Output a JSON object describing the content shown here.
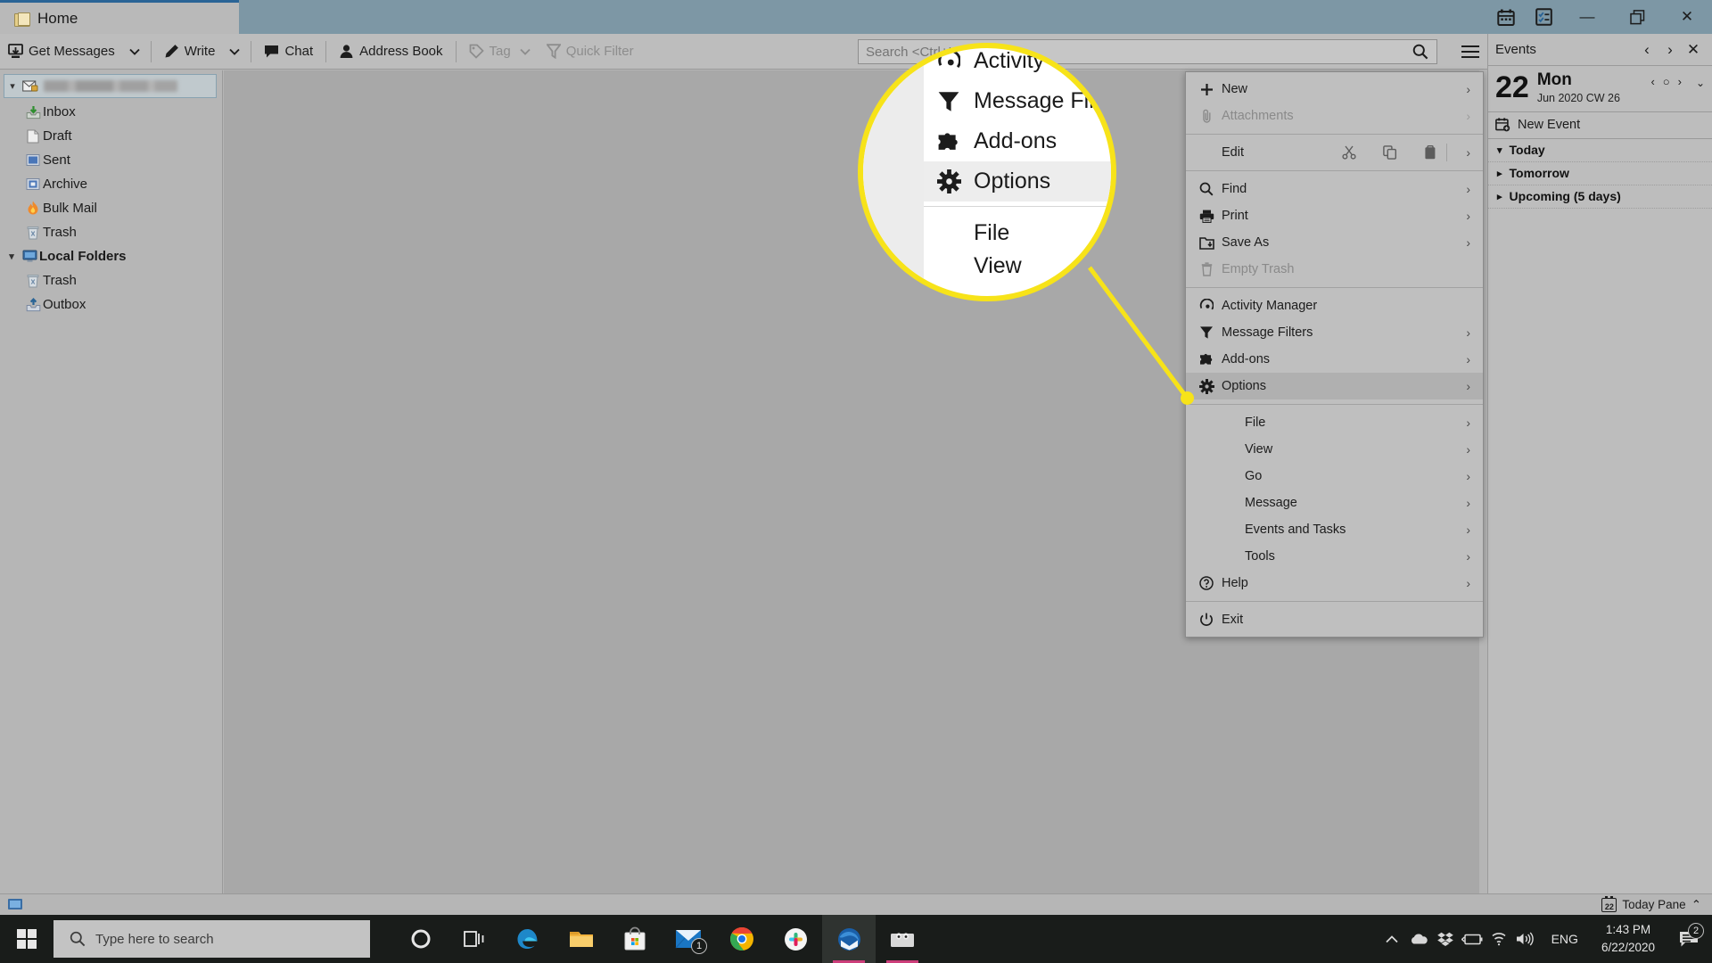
{
  "window": {
    "tab_label": "Home",
    "tab_icon": "folder-icon",
    "titlebar_buttons": [
      {
        "name": "calendar-icon",
        "label": "Calendar"
      },
      {
        "name": "tasks-icon",
        "label": "Tasks"
      }
    ],
    "controls": [
      {
        "name": "minimize-button",
        "glyph": "—"
      },
      {
        "name": "restore-button",
        "glyph": "❐"
      },
      {
        "name": "close-button",
        "glyph": "✕"
      }
    ]
  },
  "toolbar": {
    "get_messages": "Get Messages",
    "write": "Write",
    "chat": "Chat",
    "address_book": "Address Book",
    "tag": "Tag",
    "quick_filter": "Quick Filter",
    "search_placeholder": "Search <Ctrl+K>",
    "search_value": "",
    "app_menu_button": "hamburger-icon"
  },
  "folder_pane": {
    "account_row": {
      "label": "",
      "blurred": true,
      "icon": "mail-account-icon"
    },
    "account_folders": [
      {
        "label": "Inbox",
        "icon": "inbox-icon"
      },
      {
        "label": "Draft",
        "icon": "draft-icon"
      },
      {
        "label": "Sent",
        "icon": "sent-icon"
      },
      {
        "label": "Archive",
        "icon": "archive-icon"
      },
      {
        "label": "Bulk Mail",
        "icon": "bulk-mail-icon"
      },
      {
        "label": "Trash",
        "icon": "trash-icon"
      }
    ],
    "local_folders": {
      "label": "Local Folders",
      "icon": "local-folders-icon",
      "children": [
        {
          "label": "Trash",
          "icon": "trash-icon"
        },
        {
          "label": "Outbox",
          "icon": "outbox-icon"
        }
      ]
    }
  },
  "app_menu": {
    "groups": [
      {
        "items": [
          {
            "label": "New",
            "icon": "plus-icon",
            "submenu": true,
            "disabled": false,
            "selected": false,
            "indent": false
          },
          {
            "label": "Attachments",
            "icon": "paperclip-icon",
            "submenu": true,
            "disabled": true,
            "selected": false,
            "indent": false
          }
        ]
      },
      {
        "items": [
          {
            "label": "Edit",
            "icon": "",
            "submenu": true,
            "disabled": false,
            "selected": false,
            "indent": false,
            "edit_buttons": [
              "cut-icon",
              "copy-icon",
              "paste-icon"
            ]
          }
        ]
      },
      {
        "items": [
          {
            "label": "Find",
            "icon": "search-icon",
            "submenu": true,
            "disabled": false,
            "selected": false,
            "indent": false
          },
          {
            "label": "Print",
            "icon": "printer-icon",
            "submenu": true,
            "disabled": false,
            "selected": false,
            "indent": false
          },
          {
            "label": "Save As",
            "icon": "save-as-icon",
            "submenu": true,
            "disabled": false,
            "selected": false,
            "indent": false
          },
          {
            "label": "Empty Trash",
            "icon": "trash-icon",
            "submenu": false,
            "disabled": true,
            "selected": false,
            "indent": false
          }
        ]
      },
      {
        "items": [
          {
            "label": "Activity Manager",
            "icon": "activity-icon",
            "submenu": false,
            "disabled": false,
            "selected": false,
            "indent": false
          },
          {
            "label": "Message Filters",
            "icon": "filter-icon",
            "submenu": true,
            "disabled": false,
            "selected": false,
            "indent": false
          },
          {
            "label": "Add-ons",
            "icon": "puzzle-icon",
            "submenu": true,
            "disabled": false,
            "selected": false,
            "indent": false
          },
          {
            "label": "Options",
            "icon": "gear-icon",
            "submenu": true,
            "disabled": false,
            "selected": true,
            "indent": false
          }
        ]
      },
      {
        "items": [
          {
            "label": "File",
            "icon": "",
            "submenu": true,
            "disabled": false,
            "selected": false,
            "indent": true
          },
          {
            "label": "View",
            "icon": "",
            "submenu": true,
            "disabled": false,
            "selected": false,
            "indent": true
          },
          {
            "label": "Go",
            "icon": "",
            "submenu": true,
            "disabled": false,
            "selected": false,
            "indent": true
          },
          {
            "label": "Message",
            "icon": "",
            "submenu": true,
            "disabled": false,
            "selected": false,
            "indent": true
          },
          {
            "label": "Events and Tasks",
            "icon": "",
            "submenu": true,
            "disabled": false,
            "selected": false,
            "indent": true
          },
          {
            "label": "Tools",
            "icon": "",
            "submenu": true,
            "disabled": false,
            "selected": false,
            "indent": true
          },
          {
            "label": "Help",
            "icon": "help-icon",
            "submenu": true,
            "disabled": false,
            "selected": false,
            "indent": false
          }
        ]
      },
      {
        "items": [
          {
            "label": "Exit",
            "icon": "power-icon",
            "submenu": false,
            "disabled": false,
            "selected": false,
            "indent": false
          }
        ]
      }
    ]
  },
  "magnifier": {
    "highlight_color": "#f7e319",
    "items": [
      {
        "label": "Activity",
        "icon": "activity-icon",
        "highlighted": false
      },
      {
        "label": "Message Filte",
        "icon": "filter-icon",
        "highlighted": false
      },
      {
        "label": "Add-ons",
        "icon": "puzzle-icon",
        "highlighted": false
      },
      {
        "label": "Options",
        "icon": "gear-icon",
        "highlighted": true
      },
      {
        "label": "File",
        "icon": "",
        "highlighted": false
      },
      {
        "label": "View",
        "icon": "",
        "highlighted": false
      }
    ]
  },
  "today_pane": {
    "title": "Events",
    "nav": {
      "prev": "‹",
      "next": "›",
      "close": "✕"
    },
    "date": {
      "day": "22",
      "weekday": "Mon",
      "sub": "Jun 2020  CW 26",
      "prev": "‹",
      "today": "○",
      "next": "›",
      "expand": "⌄"
    },
    "new_event": "New Event",
    "sections": [
      {
        "label": "Today",
        "expanded": true
      },
      {
        "label": "Tomorrow",
        "expanded": false
      },
      {
        "label": "Upcoming (5 days)",
        "expanded": false
      }
    ]
  },
  "status_bar": {
    "today_pane_label": "Today Pane",
    "today_pane_icon_text": "22",
    "chevron": "⌃"
  },
  "taskbar": {
    "start": "windows-logo-icon",
    "search_placeholder": "Type here to search",
    "apps": [
      {
        "name": "cortana-icon",
        "badge": ""
      },
      {
        "name": "task-view-icon",
        "badge": ""
      },
      {
        "name": "edge-icon",
        "badge": ""
      },
      {
        "name": "file-explorer-icon",
        "badge": ""
      },
      {
        "name": "microsoft-store-icon",
        "badge": ""
      },
      {
        "name": "mail-icon",
        "badge": "1"
      },
      {
        "name": "chrome-icon",
        "badge": ""
      },
      {
        "name": "slack-icon",
        "badge": ""
      },
      {
        "name": "thunderbird-icon",
        "badge": ""
      },
      {
        "name": "screen-recorder-icon",
        "badge": ""
      }
    ],
    "tray": [
      {
        "name": "show-hidden-icons-icon"
      },
      {
        "name": "onedrive-icon"
      },
      {
        "name": "dropbox-icon"
      },
      {
        "name": "battery-icon"
      },
      {
        "name": "wifi-icon"
      },
      {
        "name": "volume-icon"
      }
    ],
    "language": "ENG",
    "time": "1:43 PM",
    "date": "6/22/2020",
    "notification_count": "2"
  }
}
